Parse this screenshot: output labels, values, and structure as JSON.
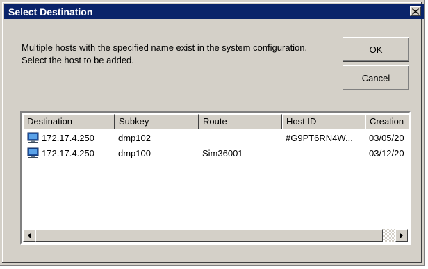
{
  "window": {
    "title": "Select Destination",
    "close_icon": "close-icon"
  },
  "message": "Multiple hosts with the specified name exist in the system configuration.  Select the host to be added.",
  "buttons": {
    "ok": "OK",
    "cancel": "Cancel"
  },
  "table": {
    "columns": [
      "Destination",
      "Subkey",
      "Route",
      "Host ID",
      "Creation"
    ],
    "rows": [
      {
        "icon": "host-computer-icon",
        "destination": "172.17.4.250",
        "subkey": "dmp102",
        "route": "",
        "host_id": "#G9PT6RN4W...",
        "creation": "03/05/20"
      },
      {
        "icon": "host-computer-icon",
        "destination": "172.17.4.250",
        "subkey": "dmp100",
        "route": "Sim36001",
        "host_id": "",
        "creation": "03/12/20"
      }
    ]
  },
  "scrollbar": {
    "left_icon": "arrow-left-icon",
    "right_icon": "arrow-right-icon"
  },
  "colors": {
    "titlebar": "#0a246a",
    "face": "#d4d0c8"
  }
}
